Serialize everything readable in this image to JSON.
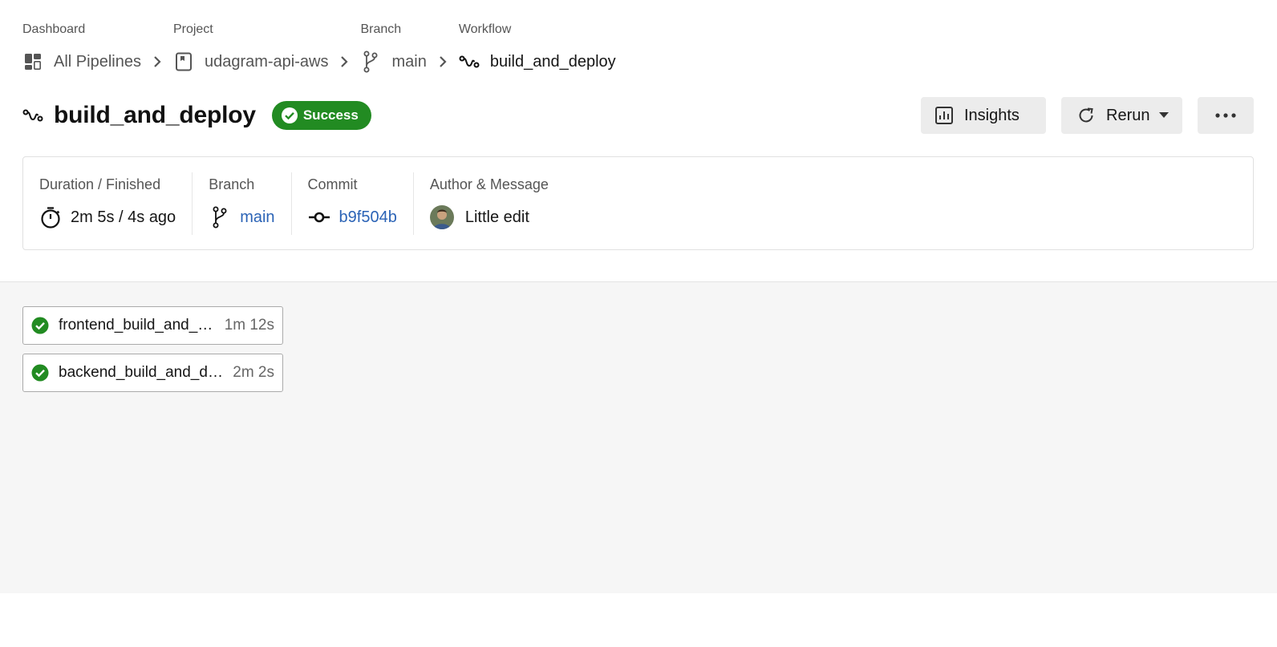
{
  "breadcrumb": {
    "items": [
      {
        "label": "Dashboard",
        "value": "All Pipelines",
        "icon": "dashboard-icon"
      },
      {
        "label": "Project",
        "value": "udagram-api-aws",
        "icon": "project-icon"
      },
      {
        "label": "Branch",
        "value": "main",
        "icon": "branch-icon"
      },
      {
        "label": "Workflow",
        "value": "build_and_deploy",
        "icon": "workflow-icon"
      }
    ]
  },
  "header": {
    "title": "build_and_deploy",
    "status": "Success",
    "status_color": "#228b22",
    "insights_label": "Insights",
    "rerun_label": "Rerun"
  },
  "info": {
    "duration": {
      "label": "Duration / Finished",
      "value": "2m 5s / 4s ago"
    },
    "branch": {
      "label": "Branch",
      "value": "main"
    },
    "commit": {
      "label": "Commit",
      "value": "b9f504b"
    },
    "author": {
      "label": "Author & Message",
      "message": "Little edit"
    }
  },
  "jobs": [
    {
      "name": "frontend_build_and_deploy",
      "duration": "1m 12s",
      "status": "success"
    },
    {
      "name": "backend_build_and_deploy",
      "duration": "2m 2s",
      "status": "success"
    }
  ],
  "colors": {
    "link": "#2b63b6",
    "success": "#228b22",
    "jobs_bg": "#f6f6f6"
  }
}
